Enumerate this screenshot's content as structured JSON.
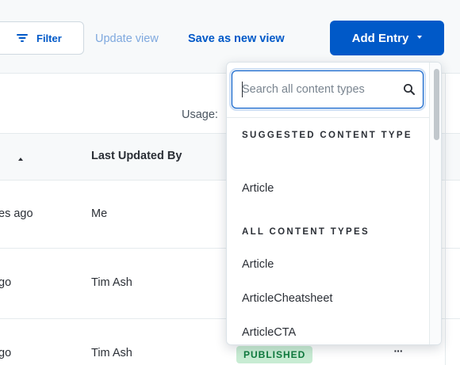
{
  "toolbar": {
    "filter_label": "Filter",
    "update_view_label": "Update view",
    "save_new_view_label": "Save as new view",
    "add_entry_label": "Add Entry"
  },
  "table": {
    "usage_label": "Usage:",
    "column_last_updated_by": "Last Updated By",
    "rows": [
      {
        "updated": "es ago",
        "updated_by": "Me"
      },
      {
        "updated": "go",
        "updated_by": "Tim Ash"
      },
      {
        "updated": "go",
        "updated_by": "Tim Ash",
        "status": "PUBLISHED",
        "more": "···"
      }
    ]
  },
  "dropdown": {
    "search_placeholder": "Search all content types",
    "search_value": "",
    "suggested_heading": "SUGGESTED CONTENT TYPE",
    "suggested_items": [
      "Article"
    ],
    "all_heading": "ALL CONTENT TYPES",
    "all_items": [
      "Article",
      "ArticleCheatsheet",
      "ArticleCTA"
    ]
  },
  "colors": {
    "primary": "#0059c8",
    "link_muted": "#7ea8de",
    "badge_bg": "#c8ecd3",
    "badge_text": "#0e7a3c"
  }
}
